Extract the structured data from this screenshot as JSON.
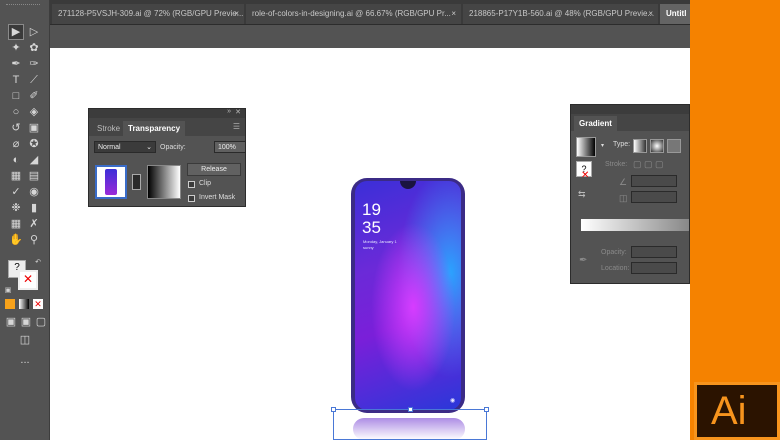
{
  "tabs": [
    {
      "label": "271128-P5VSJH-309.ai @ 72% (RGB/GPU Previe...",
      "close": "×"
    },
    {
      "label": "role-of-colors-in-designing.ai @ 66.67% (RGB/GPU Pr...",
      "close": "×"
    },
    {
      "label": "218865-P17Y1B-560.ai @ 48% (RGB/GPU Previe...",
      "close": "×"
    },
    {
      "label": "Untitl",
      "close": ""
    }
  ],
  "transparency_panel": {
    "tab_stroke": "Stroke",
    "tab_transparency": "Transparency",
    "blend_mode": "Normal",
    "opacity_label": "Opacity:",
    "opacity_value": "100%",
    "release_label": "Release",
    "clip_label": "Clip",
    "invert_mask_label": "Invert Mask"
  },
  "gradient_panel": {
    "tab_gradient": "Gradient",
    "type_label": "Type:",
    "stroke_label": "Stroke:",
    "opacity_label": "Opacity:",
    "location_label": "Location:"
  },
  "phone": {
    "hour": "19",
    "minute": "35",
    "date": "Monday, January 1",
    "sub": "sunny"
  },
  "toolbar": {
    "more": "..."
  },
  "app_logo": "Ai",
  "colors": {
    "accent": "#f58200",
    "ui_bg": "#535353",
    "selection": "#4a78d6"
  }
}
